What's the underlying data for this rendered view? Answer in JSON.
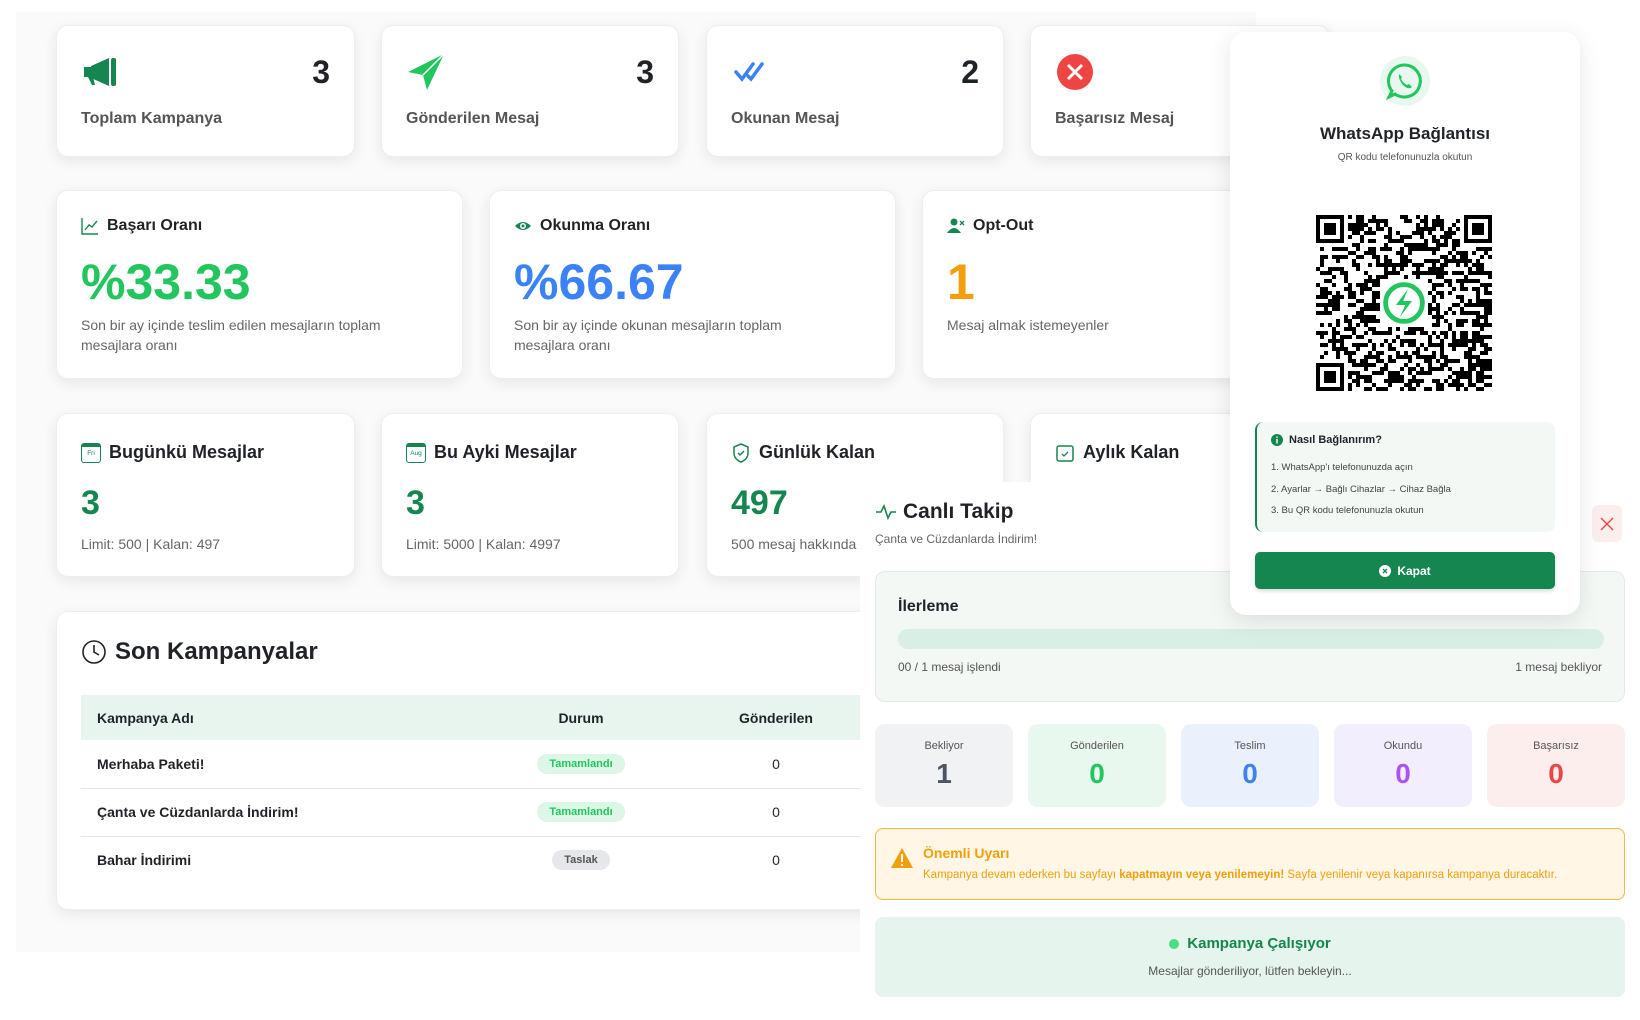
{
  "stats": [
    {
      "label": "Toplam Kampanya",
      "value": "3",
      "icon": "megaphone-icon"
    },
    {
      "label": "Gönderilen Mesaj",
      "value": "3",
      "icon": "send-icon"
    },
    {
      "label": "Okunan Mesaj",
      "value": "2",
      "icon": "double-check-icon"
    },
    {
      "label": "Başarısız Mesaj",
      "value": "",
      "icon": "error-icon"
    }
  ],
  "rates": [
    {
      "title": "Başarı Oranı",
      "value": "%33.33",
      "desc": "Son bir ay içinde teslim edilen mesajların toplam mesajlara oranı",
      "color": "#22c55e"
    },
    {
      "title": "Okunma Oranı",
      "value": "%66.67",
      "desc": "Son bir ay içinde okunan mesajların toplam mesajlara oranı",
      "color": "#3b82f6"
    },
    {
      "title": "Opt-Out",
      "value": "1",
      "desc": "Mesaj almak istemeyenler",
      "color": "#f59e0b"
    }
  ],
  "limits": [
    {
      "title": "Bugünkü Mesajlar",
      "value": "3",
      "desc": "Limit: 500 | Kalan: 497",
      "icon_text": "Fri"
    },
    {
      "title": "Bu Ayki Mesajlar",
      "value": "3",
      "desc": "Limit: 5000 | Kalan: 4997",
      "icon_text": "Aug"
    },
    {
      "title": "Günlük Kalan",
      "value": "497",
      "desc": "500 mesaj hakkında"
    },
    {
      "title": "Aylık Kalan"
    }
  ],
  "campaigns": {
    "title": "Son Kampanyalar",
    "columns": [
      "Kampanya Adı",
      "Durum",
      "Gönderilen"
    ],
    "rows": [
      {
        "name": "Merhaba Paketi!",
        "status": "Tamamlandı",
        "sent": "0"
      },
      {
        "name": "Çanta ve Cüzdanlarda İndirim!",
        "status": "Tamamlandı",
        "sent": "0"
      },
      {
        "name": "Bahar İndirimi",
        "status": "Taslak",
        "sent": "0"
      }
    ]
  },
  "live": {
    "title": "Canlı Takip",
    "subtitle": "Çanta ve Cüzdanlarda İndirim!",
    "progress_label": "İlerleme",
    "progress": 0,
    "processed": "00 / 1 mesaj işlendi",
    "waiting": "1 mesaj bekliyor",
    "counters": [
      {
        "label": "Bekliyor",
        "value": "1",
        "bg": "#f1f2f4",
        "color": "#4b5563"
      },
      {
        "label": "Gönderilen",
        "value": "0",
        "bg": "#e8f8ef",
        "color": "#22c55e"
      },
      {
        "label": "Teslim",
        "value": "0",
        "bg": "#eaf1fd",
        "color": "#3b82f6"
      },
      {
        "label": "Okundu",
        "value": "0",
        "bg": "#f3eefd",
        "color": "#a855f7"
      },
      {
        "label": "Başarısız",
        "value": "0",
        "bg": "#fdeeee",
        "color": "#ef4444"
      }
    ],
    "warning_title": "Önemli Uyarı",
    "warning_pre": "Kampanya devam ederken bu sayfayı ",
    "warning_bold": "kapatmayın veya yenilemeyin!",
    "warning_post": " Sayfa yenilenir veya kapanırsa kampanya duracaktır.",
    "running_title": "Kampanya Çalışıyor",
    "running_desc": "Mesajlar gönderiliyor, lütfen bekleyin..."
  },
  "modal": {
    "title": "WhatsApp Bağlantısı",
    "subtitle": "QR kodu telefonunuzla okutun",
    "help_title": "Nasıl Bağlanırım?",
    "steps": [
      "1. WhatsApp'ı telefonunuzda açın",
      "2. Ayarlar → Bağlı Cihazlar → Cihaz Bağla",
      "3. Bu QR kodu telefonunuzla okutun"
    ],
    "close_label": "Kapat"
  }
}
